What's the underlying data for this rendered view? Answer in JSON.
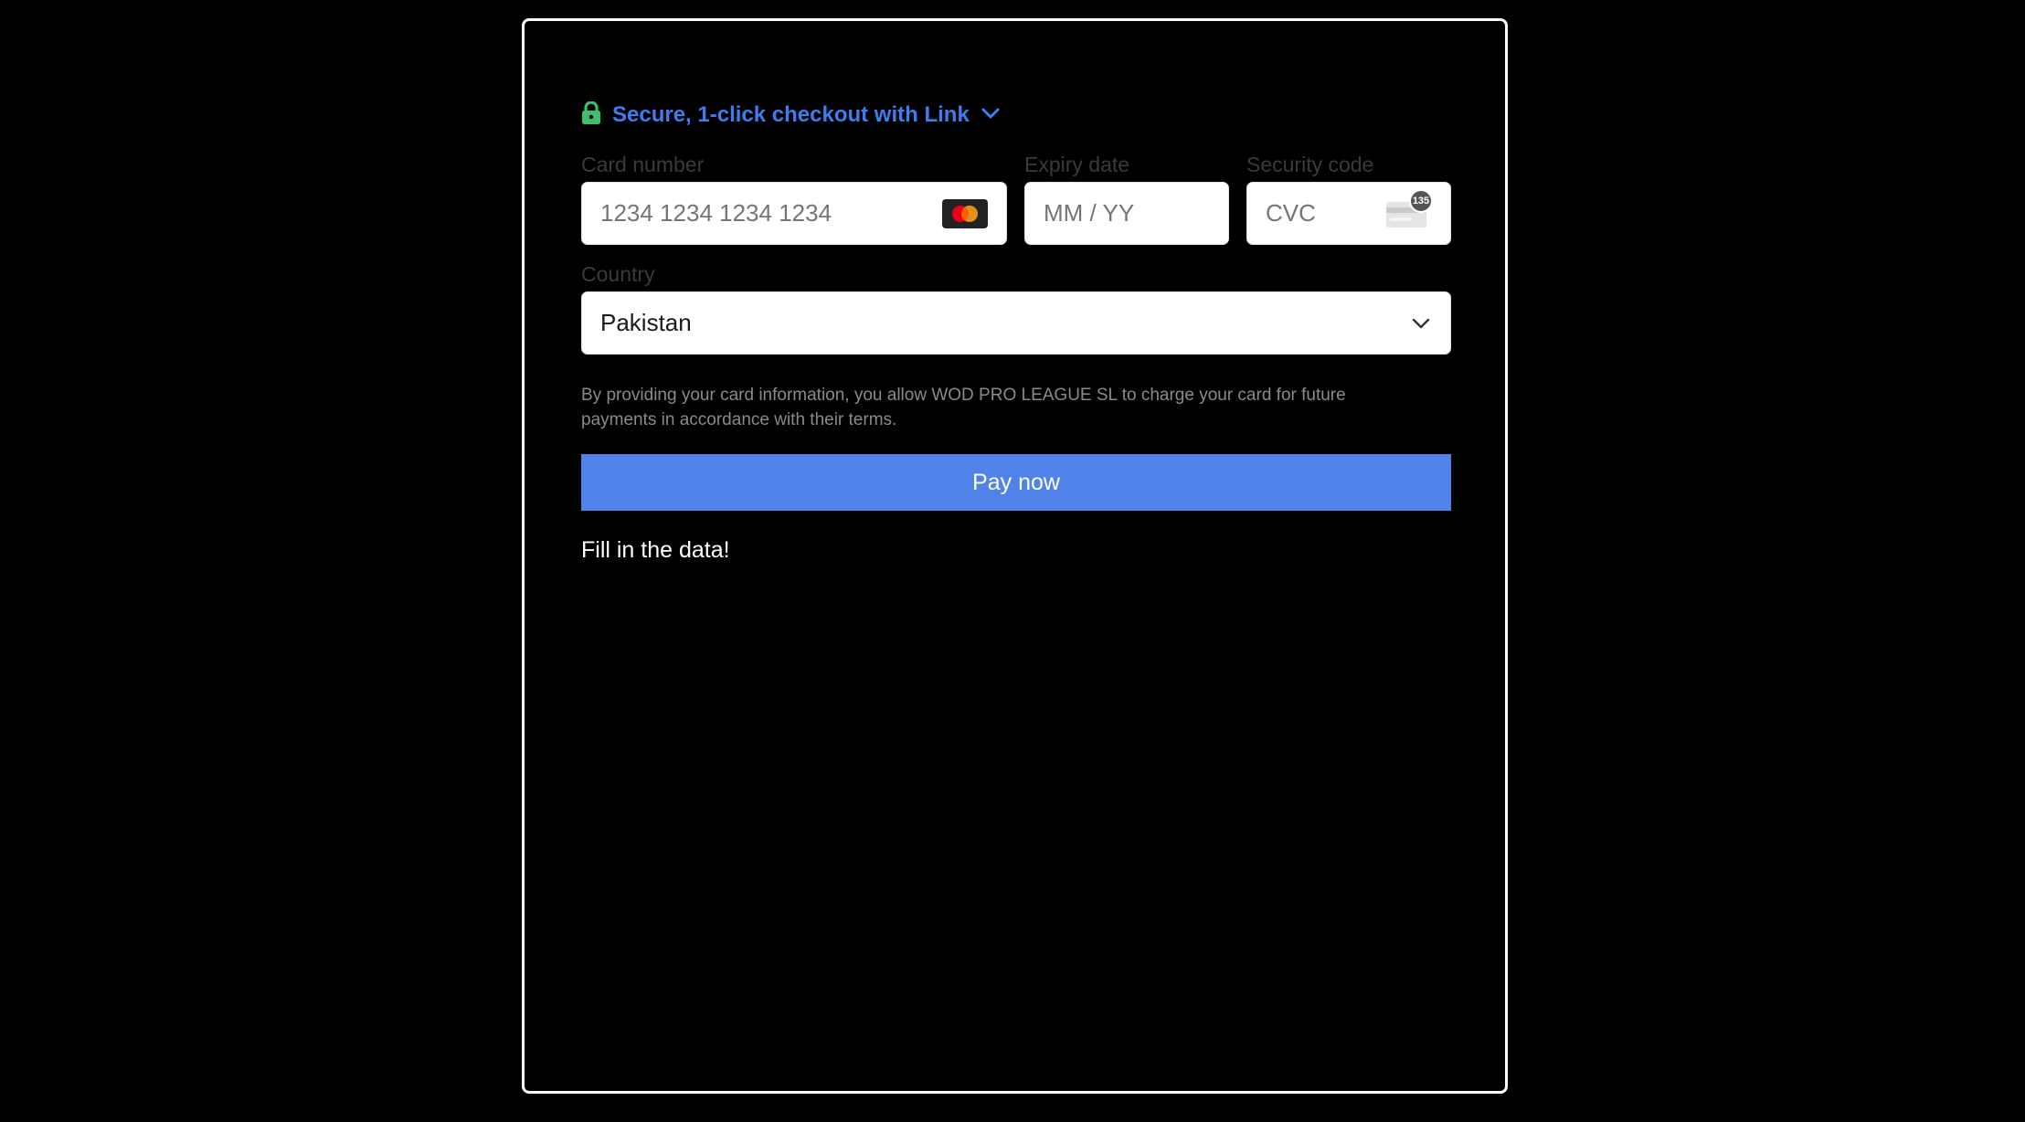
{
  "link": {
    "label": "Secure, 1-click checkout with Link",
    "color": "#3d7df0",
    "lock_icon_color": "#3fbf6e"
  },
  "card_number": {
    "label": "Card number",
    "placeholder": "1234 1234 1234 1234",
    "value": "",
    "brand_icon": "mastercard-icon"
  },
  "expiry": {
    "label": "Expiry date",
    "placeholder": "MM / YY",
    "value": ""
  },
  "security_code": {
    "label": "Security code",
    "placeholder": "CVC",
    "value": "",
    "hint_badge": "135",
    "icon": "cvc-card-icon"
  },
  "country": {
    "label": "Country",
    "selected": "Pakistan"
  },
  "consent_text": "By providing your card information, you allow WOD PRO LEAGUE SL to charge your card for future payments in accordance with their terms.",
  "pay_button": {
    "label": "Pay now",
    "color": "#5083ea"
  },
  "status_message": "Fill in the data!"
}
